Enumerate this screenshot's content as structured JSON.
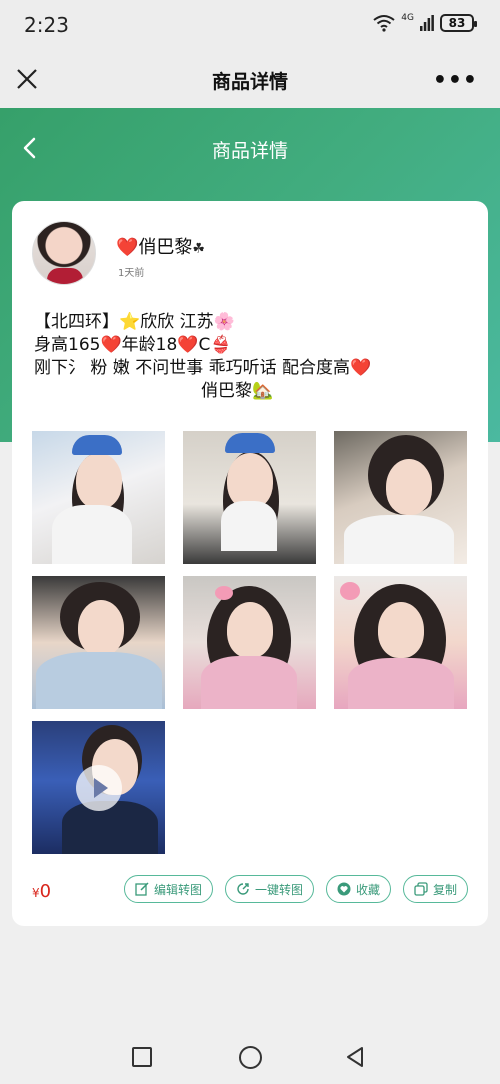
{
  "status_bar": {
    "time": "2:23",
    "signal_label": "4G",
    "battery": "83",
    "icons": [
      "wifi-icon",
      "signal-icon",
      "battery-icon"
    ]
  },
  "top_bar": {
    "title": "商品详情",
    "close_icon": "close-icon",
    "more_label": "•••"
  },
  "page_header": {
    "title": "商品详情",
    "back_icon": "chevron-left-icon"
  },
  "post": {
    "user": {
      "heart": "❤️",
      "name": "俏巴黎",
      "clover": "☘",
      "time": "1天前"
    },
    "description": {
      "line1_a": "【北四环】",
      "line1_star": "⭐",
      "line1_b": "欣欣 江苏",
      "line1_flower": "🌸",
      "line2_a": "身高165",
      "line2_heart1": "❤️",
      "line2_b": "年龄18",
      "line2_heart2": "❤️",
      "line2_c": "C",
      "line2_bikini": "👙",
      "line3_a": "刚下氵 粉 嫩 不问世事 乖巧听话 配合度高",
      "line3_heart": "❤️",
      "line4_a": "俏巴黎",
      "line4_house": "🏡"
    },
    "images": [
      {
        "name": "photo-1"
      },
      {
        "name": "photo-2"
      },
      {
        "name": "photo-3"
      },
      {
        "name": "photo-4"
      },
      {
        "name": "photo-5"
      },
      {
        "name": "photo-6"
      },
      {
        "name": "video-1",
        "is_video": true
      }
    ],
    "price_symbol": "¥",
    "price_value": "0",
    "actions": [
      {
        "label": "编辑转图",
        "icon": "edit-icon"
      },
      {
        "label": "一键转图",
        "icon": "share-icon"
      },
      {
        "label": "收藏",
        "icon": "heart-icon"
      },
      {
        "label": "复制",
        "icon": "copy-icon"
      }
    ]
  },
  "colors": {
    "accent_green": "#3aa47a",
    "price_red": "#d9261c",
    "heart_red": "#e12630"
  },
  "nav_bar": {
    "icons": [
      "recent-apps-icon",
      "home-icon",
      "back-icon"
    ]
  }
}
